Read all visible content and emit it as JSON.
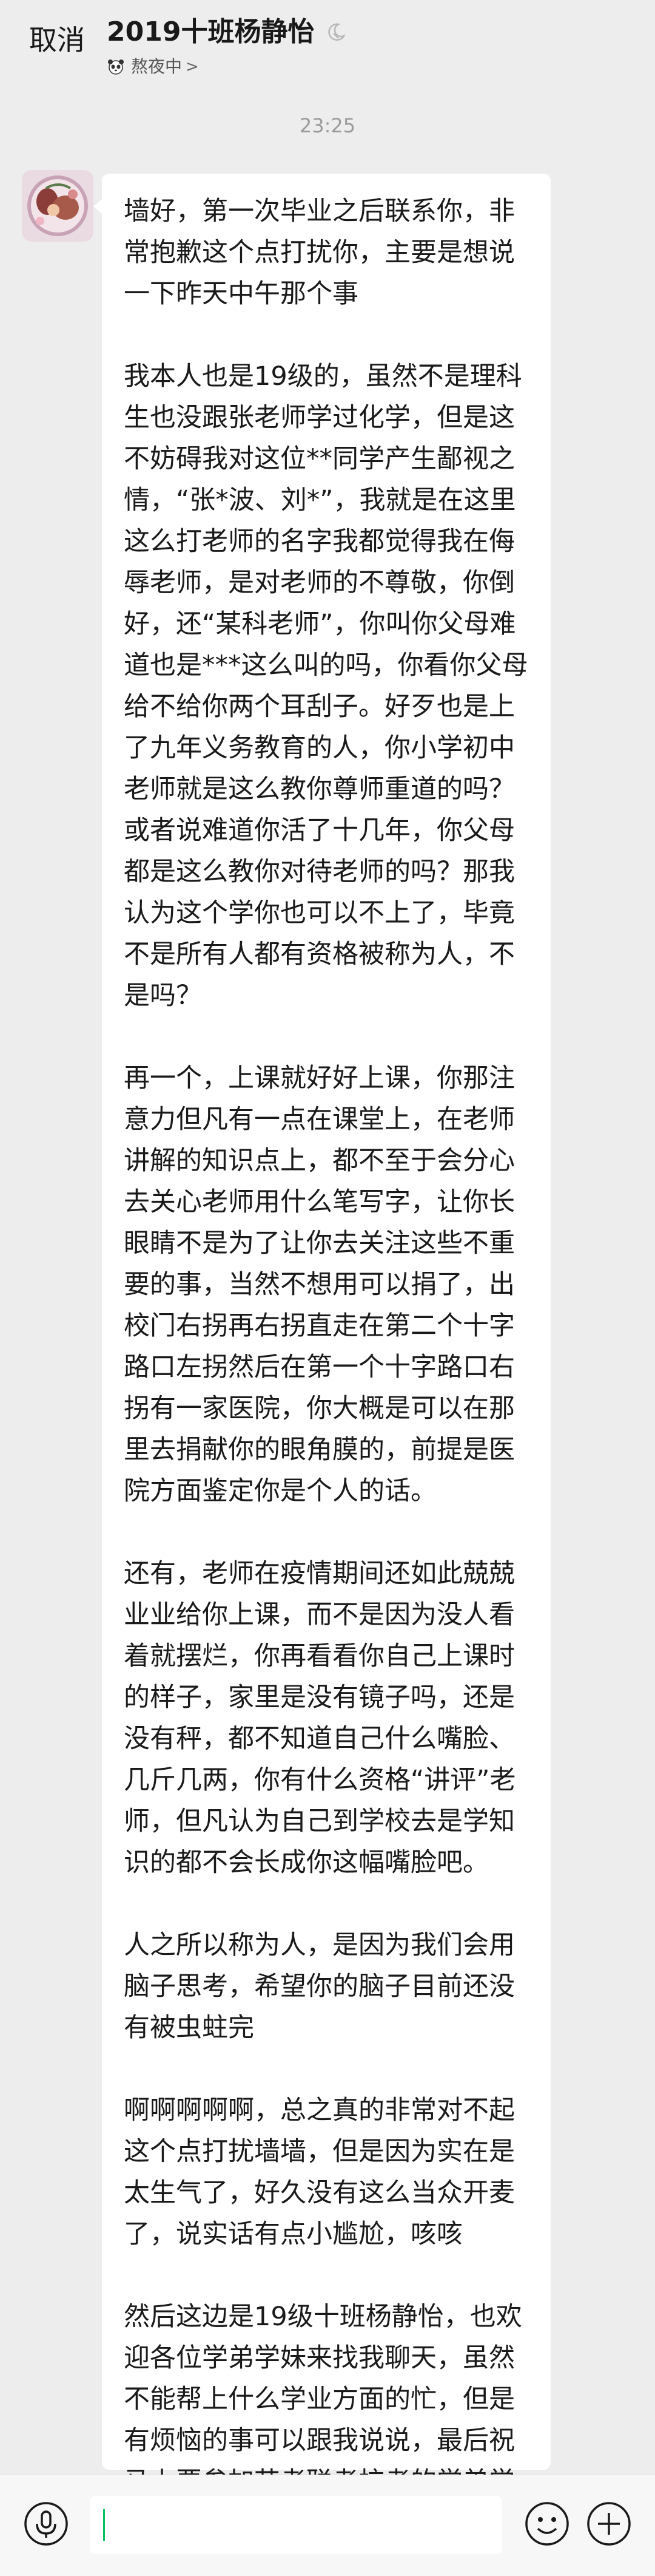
{
  "header": {
    "cancel_label": "取消",
    "title": "2019十班杨静怡",
    "status_text": "熬夜中",
    "status_chevron": ">",
    "dnd_icon": "moon-mute-icon",
    "status_icon": "panda-status-icon"
  },
  "chat": {
    "timestamp": "23:25",
    "message_paragraphs": [
      "墙好，第一次毕业之后联系你，非常抱歉这个点打扰你，主要是想说一下昨天中午那个事",
      "我本人也是19级的，虽然不是理科生也没跟张老师学过化学，但是这不妨碍我对这位**同学产生鄙视之情，“张*波、刘*”，我就是在这里这么打老师的名字我都觉得我在侮辱老师，是对老师的不尊敬，你倒好，还“某科老师”，你叫你父母难道也是***这么叫的吗，你看你父母给不给你两个耳刮子。好歹也是上了九年义务教育的人，你小学初中老师就是这么教你尊师重道的吗？或者说难道你活了十几年，你父母都是这么教你对待老师的吗？那我认为这个学你也可以不上了，毕竟不是所有人都有资格被称为人，不是吗？",
      "再一个，上课就好好上课，你那注意力但凡有一点在课堂上，在老师讲解的知识点上，都不至于会分心去关心老师用什么笔写字，让你长眼睛不是为了让你去关注这些不重要的事，当然不想用可以捐了，出校门右拐再右拐直走在第二个十字路口左拐然后在第一个十字路口右拐有一家医院，你大概是可以在那里去捐献你的眼角膜的，前提是医院方面鉴定你是个人的话。",
      "还有，老师在疫情期间还如此兢兢业业给你上课，而不是因为没人看着就摆烂，你再看看你自己上课时的样子，家里是没有镜子吗，还是没有秤，都不知道自己什么嘴脸、几斤几两，你有什么资格“讲评”老师，但凡认为自己到学校去是学知识的都不会长成你这幅嘴脸吧。",
      "人之所以称为人，是因为我们会用脑子思考，希望你的脑子目前还没有被虫蛀完",
      "啊啊啊啊啊，总之真的非常对不起这个点打扰墙墙，但是因为实在是太生气了，好久没有这么当众开麦了，说实话有点小尴尬，咳咳",
      "然后这边是19级十班杨静怡，也欢迎各位学弟学妹来找我聊天，虽然不能帮上什么学业方面的忙，但是有烦恼的事可以跟我说说，最后祝马上要参加艺考联考校考的学弟学妹们加油！"
    ]
  },
  "input_bar": {
    "input_value": "",
    "icons": [
      "voice-icon",
      "emoji-icon",
      "plus-icon"
    ],
    "accent_color": "#07c160"
  }
}
